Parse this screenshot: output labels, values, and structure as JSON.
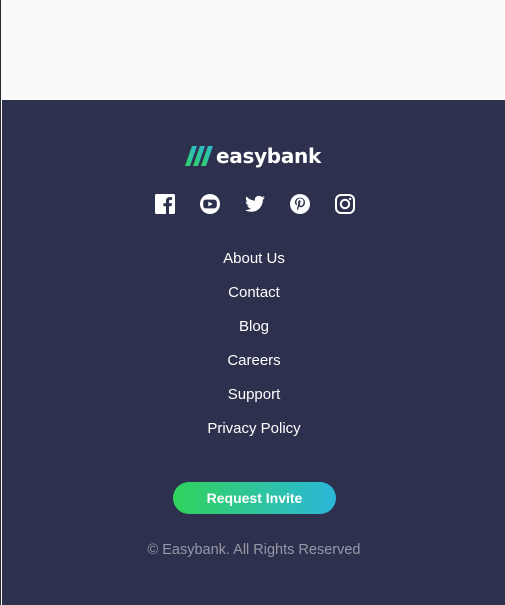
{
  "brand": {
    "name": "easybank",
    "colors": {
      "footer_background": "#2d314d",
      "cta_gradient_start": "#31d35c",
      "cta_gradient_end": "#2bb7da",
      "text_light": "#ffffff",
      "text_muted": "#9698a6"
    }
  },
  "social": [
    {
      "icon": "facebook-icon"
    },
    {
      "icon": "youtube-icon"
    },
    {
      "icon": "twitter-icon"
    },
    {
      "icon": "pinterest-icon"
    },
    {
      "icon": "instagram-icon"
    }
  ],
  "footer_links": [
    {
      "label": "About Us"
    },
    {
      "label": "Contact"
    },
    {
      "label": "Blog"
    },
    {
      "label": "Careers"
    },
    {
      "label": "Support"
    },
    {
      "label": "Privacy Policy"
    }
  ],
  "cta": {
    "label": "Request Invite"
  },
  "copyright": "© Easybank. All Rights Reserved"
}
